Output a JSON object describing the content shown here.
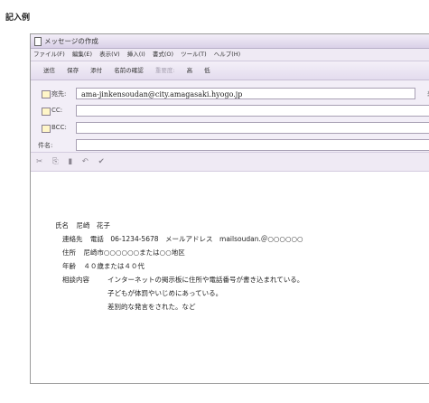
{
  "page_heading": "記入例",
  "window": {
    "title": "メッセージの作成",
    "menu": [
      "ファイル(F)",
      "編集(E)",
      "表示(V)",
      "挿入(I)",
      "書式(O)",
      "ツール(T)",
      "ヘルプ(H)"
    ],
    "toolbar": [
      "送信",
      "保存",
      "添付",
      "名前の確認",
      "重要度:",
      "高",
      "低"
    ],
    "headers": {
      "to_label": "宛先:",
      "to_value": "ama-jinkensoudan@city.amagasaki.hyogo.jp",
      "to_side": "差",
      "cc_label": "CC:",
      "cc_value": "",
      "bcc_label": "BCC:",
      "bcc_value": "",
      "subject_label": "件名:",
      "subject_value": ""
    },
    "format_icons": [
      "cut-icon",
      "copy-icon",
      "paste-icon",
      "undo-icon",
      "spellcheck-icon"
    ]
  },
  "body": {
    "name_label": "氏名",
    "name_value": "尼崎　花子",
    "contact_label": "連絡先",
    "contact_value": "電話　06-1234-5678　メールアドレス　mailsoudan.＠○○○○○○",
    "address_label": "住所",
    "address_value": "尼崎市○○○○○○または○○地区",
    "age_label": "年齢",
    "age_value": "４０歳または４０代",
    "consult_label": "相談内容",
    "consult_lines": [
      "インターネットの掲示板に住所や電話番号が書き込まれている。",
      "子どもが体罰やいじめにあっている。",
      "差別的な発言をされた。など"
    ]
  }
}
